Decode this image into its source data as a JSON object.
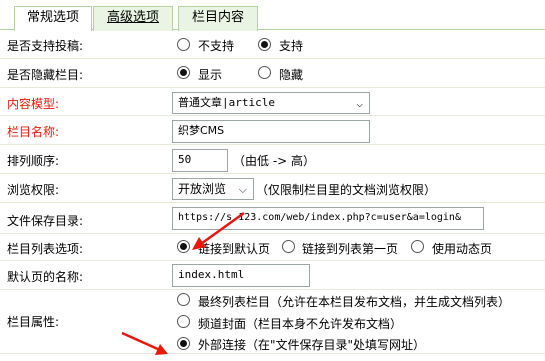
{
  "tabs": {
    "general": "常规选项",
    "advanced": "高级选项",
    "content": "栏目内容"
  },
  "fields": {
    "allow_submit": {
      "label": "是否支持投稿:",
      "options": [
        "不支持",
        "支持"
      ],
      "selected": "支持"
    },
    "hide_column": {
      "label": "是否隐藏栏目:",
      "options": [
        "显示",
        "隐藏"
      ],
      "selected": "显示"
    },
    "content_model": {
      "label": "内容模型:",
      "value": "普通文章|article"
    },
    "column_name": {
      "label": "栏目名称:",
      "value": "织梦CMS"
    },
    "sort_order": {
      "label": "排列顺序:",
      "value": "50",
      "hint": "（由低 -> 高）"
    },
    "browse_permission": {
      "label": "浏览权限:",
      "value": "开放浏览",
      "hint": "（仅限制栏目里的文档浏览权限）"
    },
    "save_dir": {
      "label": "文件保存目录:",
      "value": "https://s.123.com/web/index.php?c=user&a=login&"
    },
    "list_options": {
      "label": "栏目列表选项:",
      "options": [
        "链接到默认页",
        "链接到列表第一页",
        "使用动态页"
      ],
      "selected": "链接到默认页"
    },
    "default_page": {
      "label": "默认页的名称:",
      "value": "index.html"
    },
    "column_attr": {
      "label": "栏目属性:",
      "options": [
        "最终列表栏目（允许在本栏目发布文档，并生成文档列表）",
        "频道封面（栏目本身不允许发布文档）",
        "外部连接（在\"文件保存目录\"处填写网址）"
      ],
      "selected": "外部连接（在\"文件保存目录\"处填写网址）"
    }
  },
  "colors": {
    "required_label": "#e8180c",
    "arrow": "#e8180c",
    "tab_bg": "#e9f5e2",
    "border": "#b4d3a3"
  },
  "icons": [
    "chevron-down-icon",
    "red-arrow-icon"
  ]
}
